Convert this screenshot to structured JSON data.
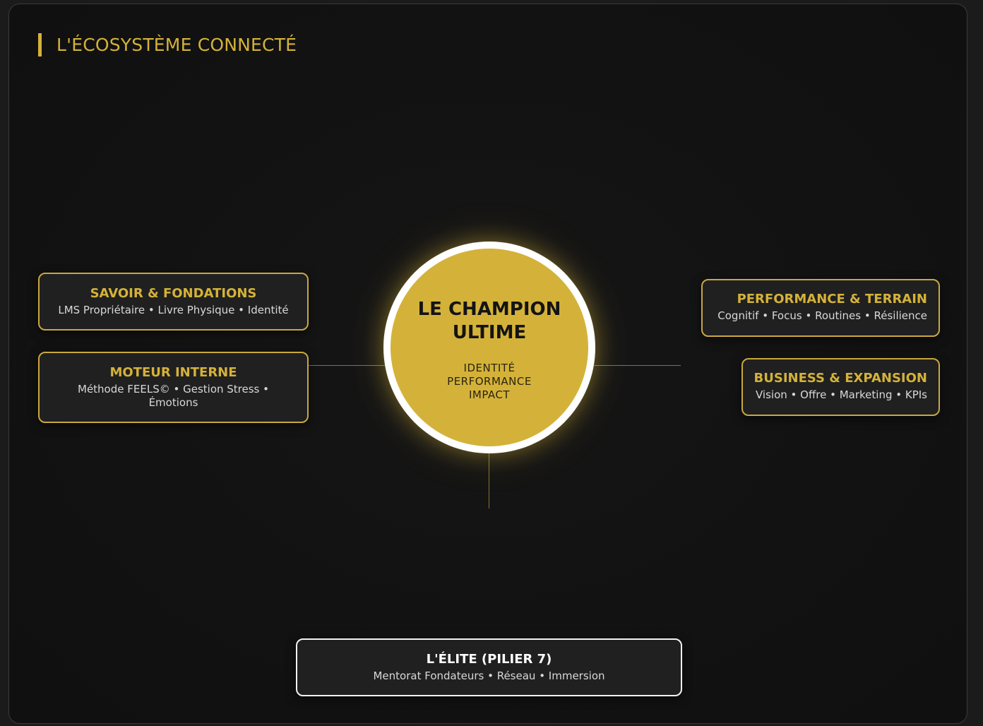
{
  "title": "L'ÉCOSYSTÈME CONNECTÉ",
  "hub": {
    "title": "LE CHAMPION ULTIME",
    "lines": [
      "IDENTITÉ",
      "PERFORMANCE",
      "IMPACT"
    ]
  },
  "nodes": {
    "savoir": {
      "title": "SAVOIR & FONDATIONS",
      "desc": "LMS Propriétaire • Livre Physique • Identité"
    },
    "moteur": {
      "title": "MOTEUR INTERNE",
      "desc": "Méthode FEELS© • Gestion Stress • Émotions"
    },
    "performance": {
      "title": "PERFORMANCE & TERRAIN",
      "desc": "Cognitif • Focus • Routines • Résilience"
    },
    "business": {
      "title": "BUSINESS & EXPANSION",
      "desc": "Vision • Offre • Marketing • KPIs"
    },
    "elite": {
      "title": "L'ÉLITE (PILIER 7)",
      "desc": "Mentorat Fondateurs • Réseau • Immersion"
    }
  },
  "colors": {
    "accent": "#d4b23a",
    "background": "#121212",
    "card": "#202020"
  }
}
